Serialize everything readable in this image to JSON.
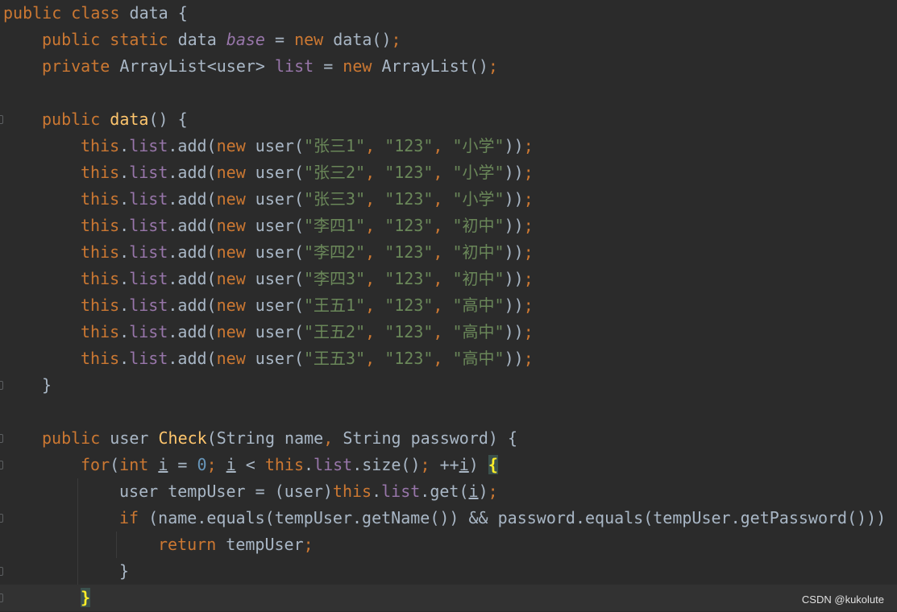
{
  "editor": {
    "lines": [
      {
        "indent": 0,
        "fold": false,
        "current": false,
        "tokens": [
          {
            "t": "public",
            "c": "kw"
          },
          {
            "t": " "
          },
          {
            "t": "class",
            "c": "kw"
          },
          {
            "t": " data {"
          }
        ]
      },
      {
        "indent": 1,
        "fold": false,
        "current": false,
        "tokens": [
          {
            "t": "public",
            "c": "kw"
          },
          {
            "t": " "
          },
          {
            "t": "static",
            "c": "kw"
          },
          {
            "t": " data "
          },
          {
            "t": "base",
            "c": "sfld"
          },
          {
            "t": " = "
          },
          {
            "t": "new",
            "c": "kw"
          },
          {
            "t": " data()"
          },
          {
            "t": ";",
            "c": "kw"
          }
        ]
      },
      {
        "indent": 1,
        "fold": false,
        "current": false,
        "tokens": [
          {
            "t": "private",
            "c": "kw"
          },
          {
            "t": " ArrayList<user> "
          },
          {
            "t": "list",
            "c": "fld"
          },
          {
            "t": " = "
          },
          {
            "t": "new",
            "c": "kw"
          },
          {
            "t": " ArrayList()"
          },
          {
            "t": ";",
            "c": "kw"
          }
        ]
      },
      {
        "indent": 0,
        "fold": false,
        "current": false,
        "tokens": []
      },
      {
        "indent": 1,
        "fold": true,
        "current": false,
        "tokens": [
          {
            "t": "public",
            "c": "kw"
          },
          {
            "t": " "
          },
          {
            "t": "data",
            "c": "fn"
          },
          {
            "t": "() {"
          }
        ]
      },
      {
        "indent": 2,
        "fold": false,
        "current": false,
        "tokens": [
          {
            "t": "this",
            "c": "kw"
          },
          {
            "t": "."
          },
          {
            "t": "list",
            "c": "fld"
          },
          {
            "t": ".add("
          },
          {
            "t": "new",
            "c": "kw"
          },
          {
            "t": " user("
          },
          {
            "t": "\"张三1\"",
            "c": "str"
          },
          {
            "t": ", ",
            "c": "kw"
          },
          {
            "t": "\"123\"",
            "c": "str"
          },
          {
            "t": ", ",
            "c": "kw"
          },
          {
            "t": "\"小学\"",
            "c": "str"
          },
          {
            "t": "))"
          },
          {
            "t": ";",
            "c": "kw"
          }
        ]
      },
      {
        "indent": 2,
        "fold": false,
        "current": false,
        "tokens": [
          {
            "t": "this",
            "c": "kw"
          },
          {
            "t": "."
          },
          {
            "t": "list",
            "c": "fld"
          },
          {
            "t": ".add("
          },
          {
            "t": "new",
            "c": "kw"
          },
          {
            "t": " user("
          },
          {
            "t": "\"张三2\"",
            "c": "str"
          },
          {
            "t": ", ",
            "c": "kw"
          },
          {
            "t": "\"123\"",
            "c": "str"
          },
          {
            "t": ", ",
            "c": "kw"
          },
          {
            "t": "\"小学\"",
            "c": "str"
          },
          {
            "t": "))"
          },
          {
            "t": ";",
            "c": "kw"
          }
        ]
      },
      {
        "indent": 2,
        "fold": false,
        "current": false,
        "tokens": [
          {
            "t": "this",
            "c": "kw"
          },
          {
            "t": "."
          },
          {
            "t": "list",
            "c": "fld"
          },
          {
            "t": ".add("
          },
          {
            "t": "new",
            "c": "kw"
          },
          {
            "t": " user("
          },
          {
            "t": "\"张三3\"",
            "c": "str"
          },
          {
            "t": ", ",
            "c": "kw"
          },
          {
            "t": "\"123\"",
            "c": "str"
          },
          {
            "t": ", ",
            "c": "kw"
          },
          {
            "t": "\"小学\"",
            "c": "str"
          },
          {
            "t": "))"
          },
          {
            "t": ";",
            "c": "kw"
          }
        ]
      },
      {
        "indent": 2,
        "fold": false,
        "current": false,
        "tokens": [
          {
            "t": "this",
            "c": "kw"
          },
          {
            "t": "."
          },
          {
            "t": "list",
            "c": "fld"
          },
          {
            "t": ".add("
          },
          {
            "t": "new",
            "c": "kw"
          },
          {
            "t": " user("
          },
          {
            "t": "\"李四1\"",
            "c": "str"
          },
          {
            "t": ", ",
            "c": "kw"
          },
          {
            "t": "\"123\"",
            "c": "str"
          },
          {
            "t": ", ",
            "c": "kw"
          },
          {
            "t": "\"初中\"",
            "c": "str"
          },
          {
            "t": "))"
          },
          {
            "t": ";",
            "c": "kw"
          }
        ]
      },
      {
        "indent": 2,
        "fold": false,
        "current": false,
        "tokens": [
          {
            "t": "this",
            "c": "kw"
          },
          {
            "t": "."
          },
          {
            "t": "list",
            "c": "fld"
          },
          {
            "t": ".add("
          },
          {
            "t": "new",
            "c": "kw"
          },
          {
            "t": " user("
          },
          {
            "t": "\"李四2\"",
            "c": "str"
          },
          {
            "t": ", ",
            "c": "kw"
          },
          {
            "t": "\"123\"",
            "c": "str"
          },
          {
            "t": ", ",
            "c": "kw"
          },
          {
            "t": "\"初中\"",
            "c": "str"
          },
          {
            "t": "))"
          },
          {
            "t": ";",
            "c": "kw"
          }
        ]
      },
      {
        "indent": 2,
        "fold": false,
        "current": false,
        "tokens": [
          {
            "t": "this",
            "c": "kw"
          },
          {
            "t": "."
          },
          {
            "t": "list",
            "c": "fld"
          },
          {
            "t": ".add("
          },
          {
            "t": "new",
            "c": "kw"
          },
          {
            "t": " user("
          },
          {
            "t": "\"李四3\"",
            "c": "str"
          },
          {
            "t": ", ",
            "c": "kw"
          },
          {
            "t": "\"123\"",
            "c": "str"
          },
          {
            "t": ", ",
            "c": "kw"
          },
          {
            "t": "\"初中\"",
            "c": "str"
          },
          {
            "t": "))"
          },
          {
            "t": ";",
            "c": "kw"
          }
        ]
      },
      {
        "indent": 2,
        "fold": false,
        "current": false,
        "tokens": [
          {
            "t": "this",
            "c": "kw"
          },
          {
            "t": "."
          },
          {
            "t": "list",
            "c": "fld"
          },
          {
            "t": ".add("
          },
          {
            "t": "new",
            "c": "kw"
          },
          {
            "t": " user("
          },
          {
            "t": "\"王五1\"",
            "c": "str"
          },
          {
            "t": ", ",
            "c": "kw"
          },
          {
            "t": "\"123\"",
            "c": "str"
          },
          {
            "t": ", ",
            "c": "kw"
          },
          {
            "t": "\"高中\"",
            "c": "str"
          },
          {
            "t": "))"
          },
          {
            "t": ";",
            "c": "kw"
          }
        ]
      },
      {
        "indent": 2,
        "fold": false,
        "current": false,
        "tokens": [
          {
            "t": "this",
            "c": "kw"
          },
          {
            "t": "."
          },
          {
            "t": "list",
            "c": "fld"
          },
          {
            "t": ".add("
          },
          {
            "t": "new",
            "c": "kw"
          },
          {
            "t": " user("
          },
          {
            "t": "\"王五2\"",
            "c": "str"
          },
          {
            "t": ", ",
            "c": "kw"
          },
          {
            "t": "\"123\"",
            "c": "str"
          },
          {
            "t": ", ",
            "c": "kw"
          },
          {
            "t": "\"高中\"",
            "c": "str"
          },
          {
            "t": "))"
          },
          {
            "t": ";",
            "c": "kw"
          }
        ]
      },
      {
        "indent": 2,
        "fold": false,
        "current": false,
        "tokens": [
          {
            "t": "this",
            "c": "kw"
          },
          {
            "t": "."
          },
          {
            "t": "list",
            "c": "fld"
          },
          {
            "t": ".add("
          },
          {
            "t": "new",
            "c": "kw"
          },
          {
            "t": " user("
          },
          {
            "t": "\"王五3\"",
            "c": "str"
          },
          {
            "t": ", ",
            "c": "kw"
          },
          {
            "t": "\"123\"",
            "c": "str"
          },
          {
            "t": ", ",
            "c": "kw"
          },
          {
            "t": "\"高中\"",
            "c": "str"
          },
          {
            "t": "))"
          },
          {
            "t": ";",
            "c": "kw"
          }
        ]
      },
      {
        "indent": 1,
        "fold": true,
        "current": false,
        "tokens": [
          {
            "t": "}"
          }
        ]
      },
      {
        "indent": 0,
        "fold": false,
        "current": false,
        "tokens": []
      },
      {
        "indent": 1,
        "fold": true,
        "current": false,
        "tokens": [
          {
            "t": "public",
            "c": "kw"
          },
          {
            "t": " user "
          },
          {
            "t": "Check",
            "c": "fn"
          },
          {
            "t": "(String name"
          },
          {
            "t": ", ",
            "c": "kw"
          },
          {
            "t": "String password) {"
          }
        ]
      },
      {
        "indent": 2,
        "fold": true,
        "current": false,
        "tokens": [
          {
            "t": "for",
            "c": "kw"
          },
          {
            "t": "("
          },
          {
            "t": "int",
            "c": "kw"
          },
          {
            "t": " "
          },
          {
            "t": "i",
            "c": "ul"
          },
          {
            "t": " = "
          },
          {
            "t": "0",
            "c": "num"
          },
          {
            "t": "; ",
            "c": "kw"
          },
          {
            "t": "i",
            "c": "ul"
          },
          {
            "t": " < "
          },
          {
            "t": "this",
            "c": "kw"
          },
          {
            "t": "."
          },
          {
            "t": "list",
            "c": "fld"
          },
          {
            "t": ".size()"
          },
          {
            "t": "; ",
            "c": "kw"
          },
          {
            "t": "++"
          },
          {
            "t": "i",
            "c": "ul"
          },
          {
            "t": ") "
          },
          {
            "t": "{",
            "c": "brace-hl"
          }
        ]
      },
      {
        "indent": 3,
        "fold": false,
        "current": false,
        "tokens": [
          {
            "t": "user tempUser = (user)"
          },
          {
            "t": "this",
            "c": "kw"
          },
          {
            "t": "."
          },
          {
            "t": "list",
            "c": "fld"
          },
          {
            "t": ".get("
          },
          {
            "t": "i",
            "c": "ul"
          },
          {
            "t": ")"
          },
          {
            "t": ";",
            "c": "kw"
          }
        ]
      },
      {
        "indent": 3,
        "fold": true,
        "current": false,
        "tokens": [
          {
            "t": "if",
            "c": "kw"
          },
          {
            "t": " (name.equals(tempUser.getName()) && password.equals(tempUser.getPassword())) {"
          }
        ]
      },
      {
        "indent": 4,
        "fold": false,
        "current": false,
        "tokens": [
          {
            "t": "return",
            "c": "kw"
          },
          {
            "t": " tempUser"
          },
          {
            "t": ";",
            "c": "kw"
          }
        ]
      },
      {
        "indent": 3,
        "fold": true,
        "current": false,
        "tokens": [
          {
            "t": "}"
          }
        ]
      },
      {
        "indent": 2,
        "fold": true,
        "current": true,
        "tokens": [
          {
            "t": "}",
            "c": "brace-hl"
          }
        ]
      }
    ]
  },
  "watermark": "CSDN @kukolute"
}
